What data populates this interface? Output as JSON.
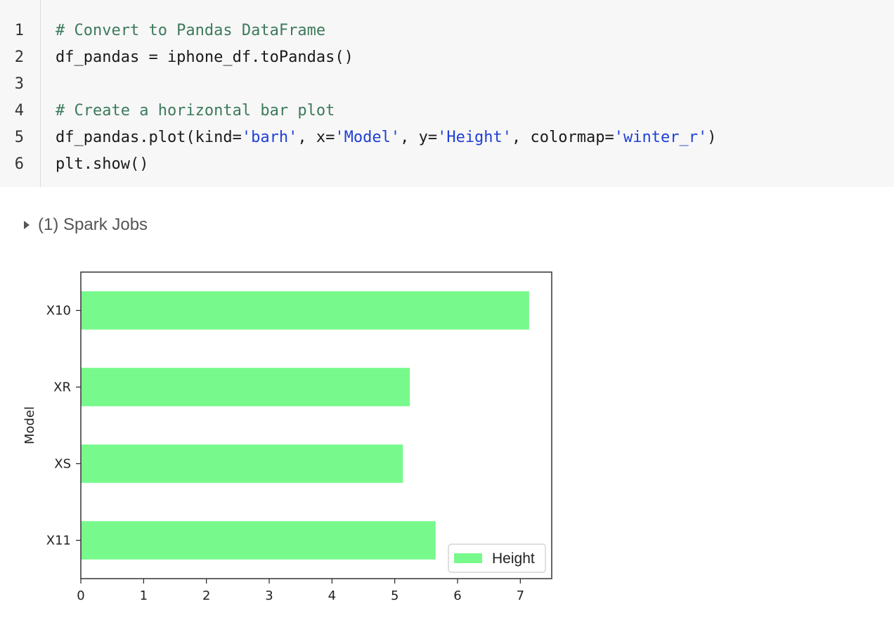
{
  "code_cell": {
    "line_numbers": [
      "1",
      "2",
      "3",
      "4",
      "5",
      "6"
    ],
    "lines": [
      [
        {
          "type": "comment",
          "text": "# Convert to Pandas DataFrame"
        }
      ],
      [
        {
          "type": "plain",
          "text": "df_pandas = iphone_df.toPandas()"
        }
      ],
      [],
      [
        {
          "type": "comment",
          "text": "# Create a horizontal bar plot"
        }
      ],
      [
        {
          "type": "plain",
          "text": "df_pandas.plot(kind="
        },
        {
          "type": "string",
          "text": "'barh'"
        },
        {
          "type": "plain",
          "text": ", x="
        },
        {
          "type": "string",
          "text": "'Model'"
        },
        {
          "type": "plain",
          "text": ", y="
        },
        {
          "type": "string",
          "text": "'Height'"
        },
        {
          "type": "plain",
          "text": ", colormap="
        },
        {
          "type": "string",
          "text": "'winter_r'"
        },
        {
          "type": "plain",
          "text": ")"
        }
      ],
      [
        {
          "type": "plain",
          "text": "plt.show()"
        }
      ]
    ]
  },
  "spark_jobs": {
    "label": "(1) Spark Jobs"
  },
  "chart_data": {
    "type": "bar",
    "orientation": "horizontal",
    "categories": [
      "X11",
      "XS",
      "XR",
      "X10"
    ],
    "series": [
      {
        "name": "Height",
        "values": [
          5.65,
          5.13,
          5.24,
          7.14
        ],
        "color": "#77f98c"
      }
    ],
    "ylabel": "Model",
    "xlim": [
      0,
      7.5
    ],
    "xticks": [
      "0",
      "1",
      "2",
      "3",
      "4",
      "5",
      "6",
      "7"
    ],
    "grid": false,
    "legend": "lower-right"
  }
}
